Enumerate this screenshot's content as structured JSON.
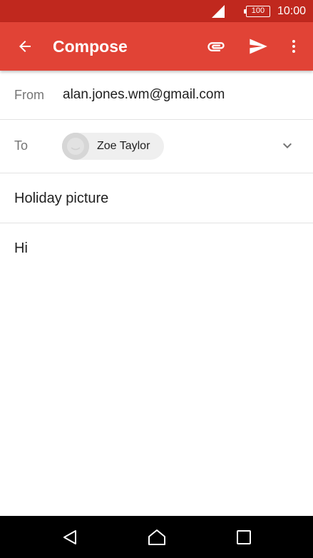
{
  "status_bar": {
    "battery_label": "100",
    "time": "10:00",
    "icons": [
      "signal-icon",
      "battery-icon"
    ]
  },
  "app_bar": {
    "title": "Compose",
    "icons": [
      "back-arrow-icon",
      "paperclip-icon",
      "send-icon",
      "more-vert-icon"
    ],
    "color": "#e14336"
  },
  "compose": {
    "from_label": "From",
    "from_value": "alan.jones.wm@gmail.com",
    "to_label": "To",
    "recipient_name": "Zoe Taylor",
    "subject": "Holiday picture",
    "body": "Hi"
  },
  "nav_bar": {
    "icons": [
      "nav-back-icon",
      "nav-home-icon",
      "nav-recent-icon"
    ]
  },
  "colors": {
    "status_bar": "#c0281e",
    "accent": "#e14336",
    "chip_background": "#efefef"
  }
}
